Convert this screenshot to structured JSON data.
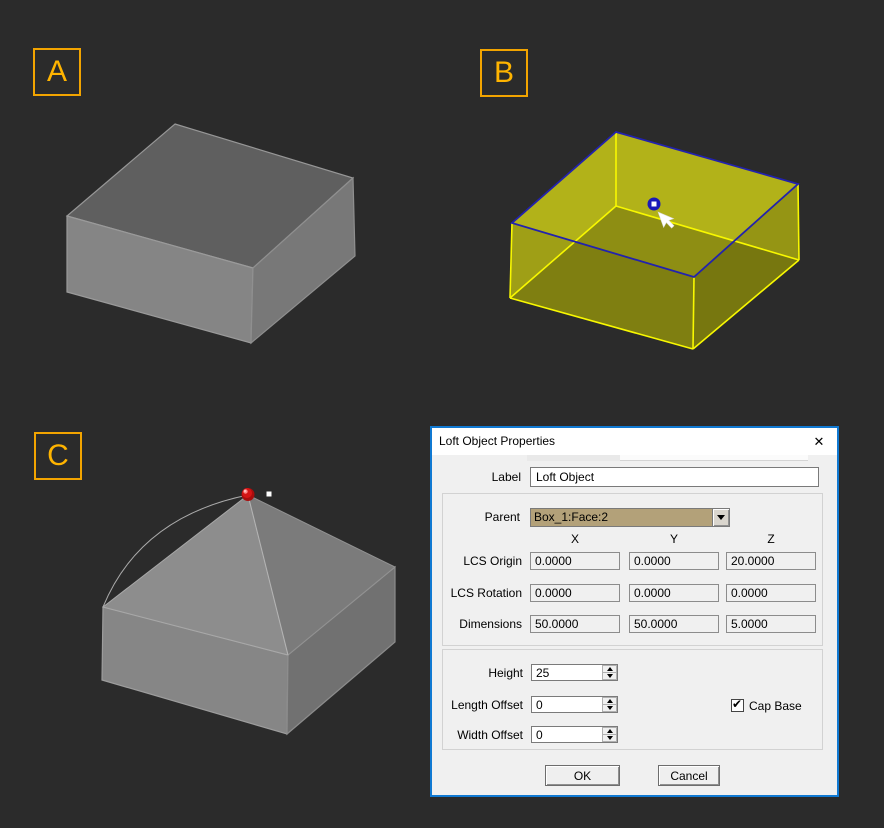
{
  "scene": {
    "background_color": "#2b2b2b",
    "label_accent_color": "#ffb400",
    "panel_labels": [
      {
        "letter": "A"
      },
      {
        "letter": "B"
      },
      {
        "letter": "C"
      }
    ],
    "gray_box_colors": {
      "top": "#5f5f5f",
      "front": "#858585",
      "right": "#787878"
    },
    "selected_box_colors": {
      "fill": "#b2b219",
      "interior": "#8e8e13",
      "edge_yellow": "#f8f800",
      "edge_blue": "#2222ae"
    },
    "loft_apex_color": "#d01212",
    "selection_marker_color": "#1a1ab8"
  },
  "dialog": {
    "title": "Loft Object Properties",
    "icons": {
      "close_icon": "✕",
      "checkmark_icon": "✔",
      "dropdown_arrow_icon": "triangle-down",
      "spin_up_icon": "triangle-up",
      "spin_down_icon": "triangle-down"
    },
    "label_field": {
      "label": "Label",
      "value": "Loft Object"
    },
    "parent_field": {
      "label": "Parent",
      "value": "Box_1:Face:2",
      "highlight_color": "#b3a179"
    },
    "axis_columns": [
      "X",
      "Y",
      "Z"
    ],
    "rows": [
      {
        "label": "LCS Origin",
        "values": [
          "0.0000",
          "0.0000",
          "20.0000"
        ]
      },
      {
        "label": "LCS Rotation",
        "values": [
          "0.0000",
          "0.0000",
          "0.0000"
        ]
      },
      {
        "label": "Dimensions",
        "values": [
          "50.0000",
          "50.0000",
          "5.0000"
        ]
      }
    ],
    "spinners": [
      {
        "label": "Height",
        "value": "25"
      },
      {
        "label": "Length Offset",
        "value": "0"
      },
      {
        "label": "Width Offset",
        "value": "0"
      }
    ],
    "cap_base": {
      "label": "Cap Base",
      "checked": true
    },
    "buttons": [
      {
        "label": "OK"
      },
      {
        "label": "Cancel"
      }
    ]
  }
}
